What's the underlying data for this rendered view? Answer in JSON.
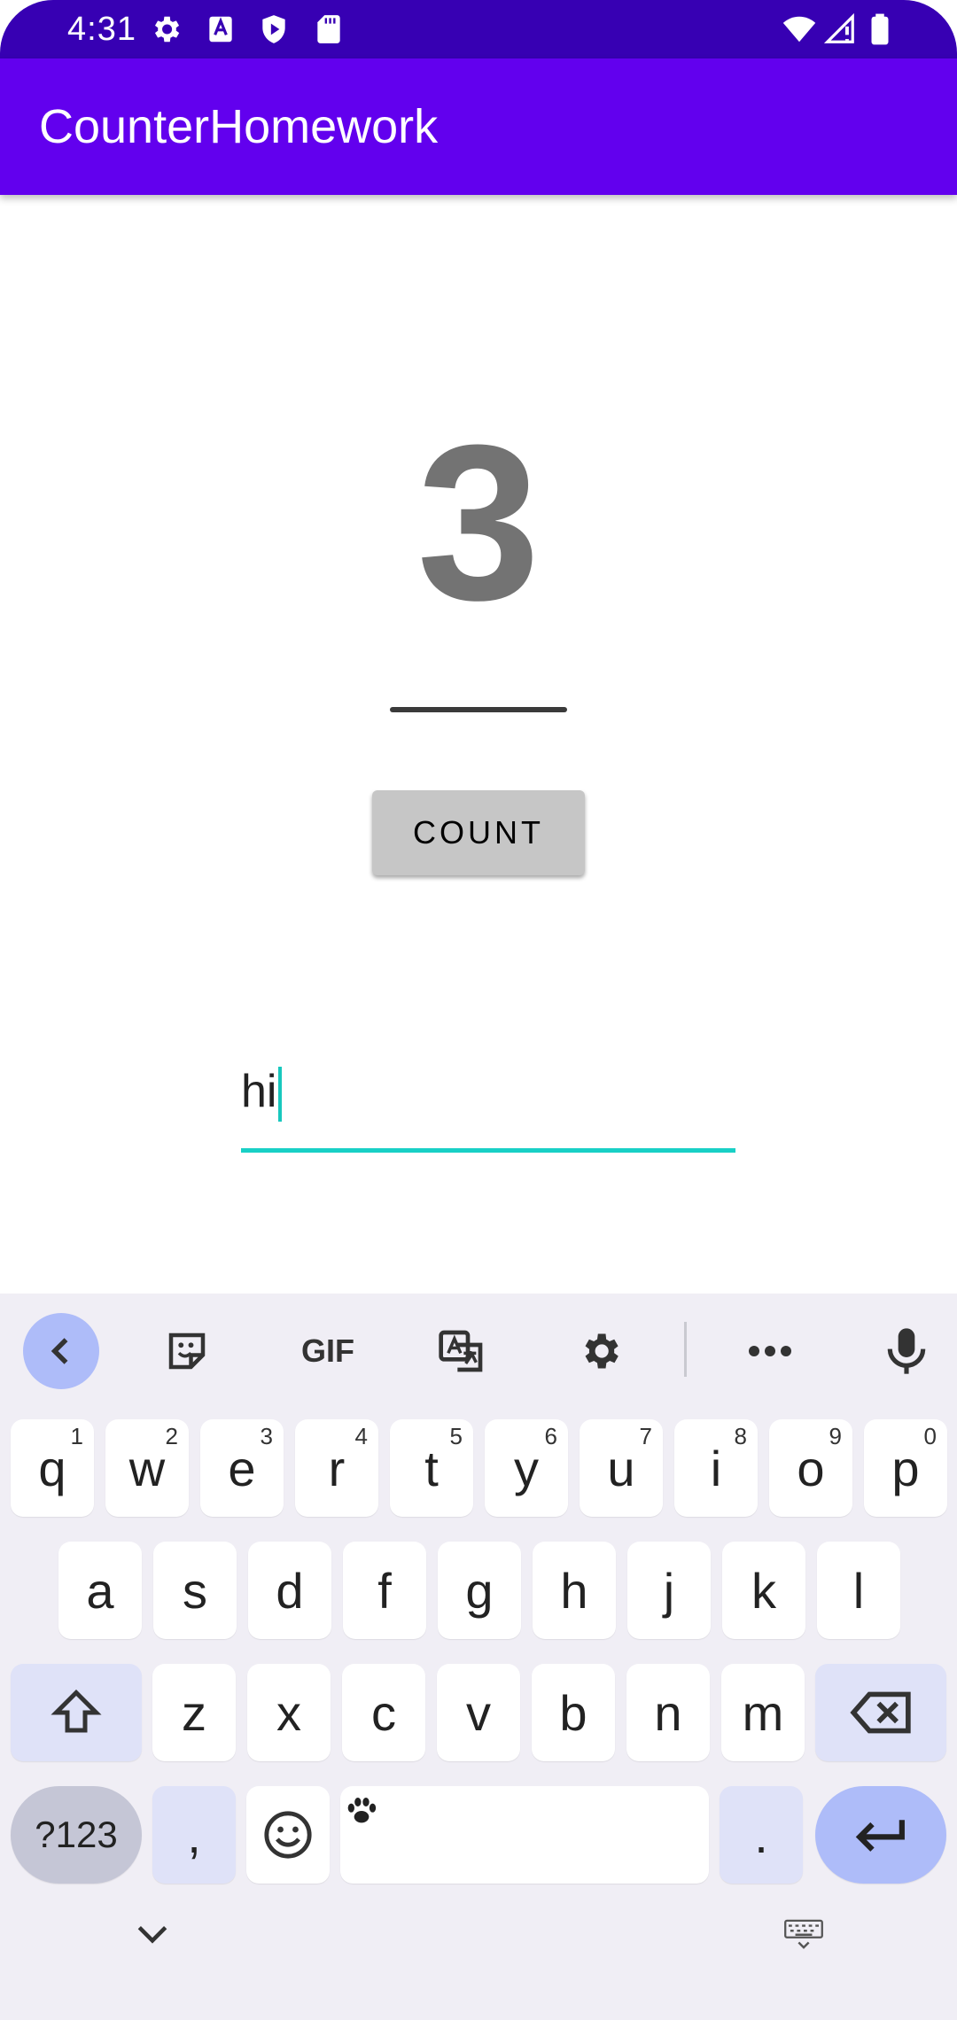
{
  "status_bar": {
    "time": "4:31",
    "left_icons": [
      "gear-icon",
      "text-icon",
      "shield-play-icon",
      "sd-card-icon"
    ],
    "right_icons": [
      "wifi-icon",
      "signal-icon",
      "battery-icon"
    ]
  },
  "app_bar": {
    "title": "CounterHomework"
  },
  "counter": {
    "value": "3"
  },
  "count_button": {
    "label": "COUNT"
  },
  "text_field": {
    "value": "hi"
  },
  "keyboard": {
    "toolbar": [
      "chevron-left-icon",
      "sticker-icon",
      "GIF",
      "translate-icon",
      "gear-icon",
      "more-icon",
      "mic-icon"
    ],
    "gif_label": "GIF",
    "row1": [
      {
        "key": "q",
        "hint": "1"
      },
      {
        "key": "w",
        "hint": "2"
      },
      {
        "key": "e",
        "hint": "3"
      },
      {
        "key": "r",
        "hint": "4"
      },
      {
        "key": "t",
        "hint": "5"
      },
      {
        "key": "y",
        "hint": "6"
      },
      {
        "key": "u",
        "hint": "7"
      },
      {
        "key": "i",
        "hint": "8"
      },
      {
        "key": "o",
        "hint": "9"
      },
      {
        "key": "p",
        "hint": "0"
      }
    ],
    "row2": [
      "a",
      "s",
      "d",
      "f",
      "g",
      "h",
      "j",
      "k",
      "l"
    ],
    "row3": [
      "z",
      "x",
      "c",
      "v",
      "b",
      "n",
      "m"
    ],
    "row4": {
      "symbols": "?123",
      "comma": ",",
      "period": "."
    },
    "colors": {
      "accent": "#aebcf9",
      "modifier": "#dfe2f8",
      "background": "#f0eef5"
    }
  },
  "colors": {
    "status_bar": "#3700b3",
    "app_bar": "#6200ee",
    "field_underline": "#18d0c6",
    "counter_text": "#737373"
  }
}
